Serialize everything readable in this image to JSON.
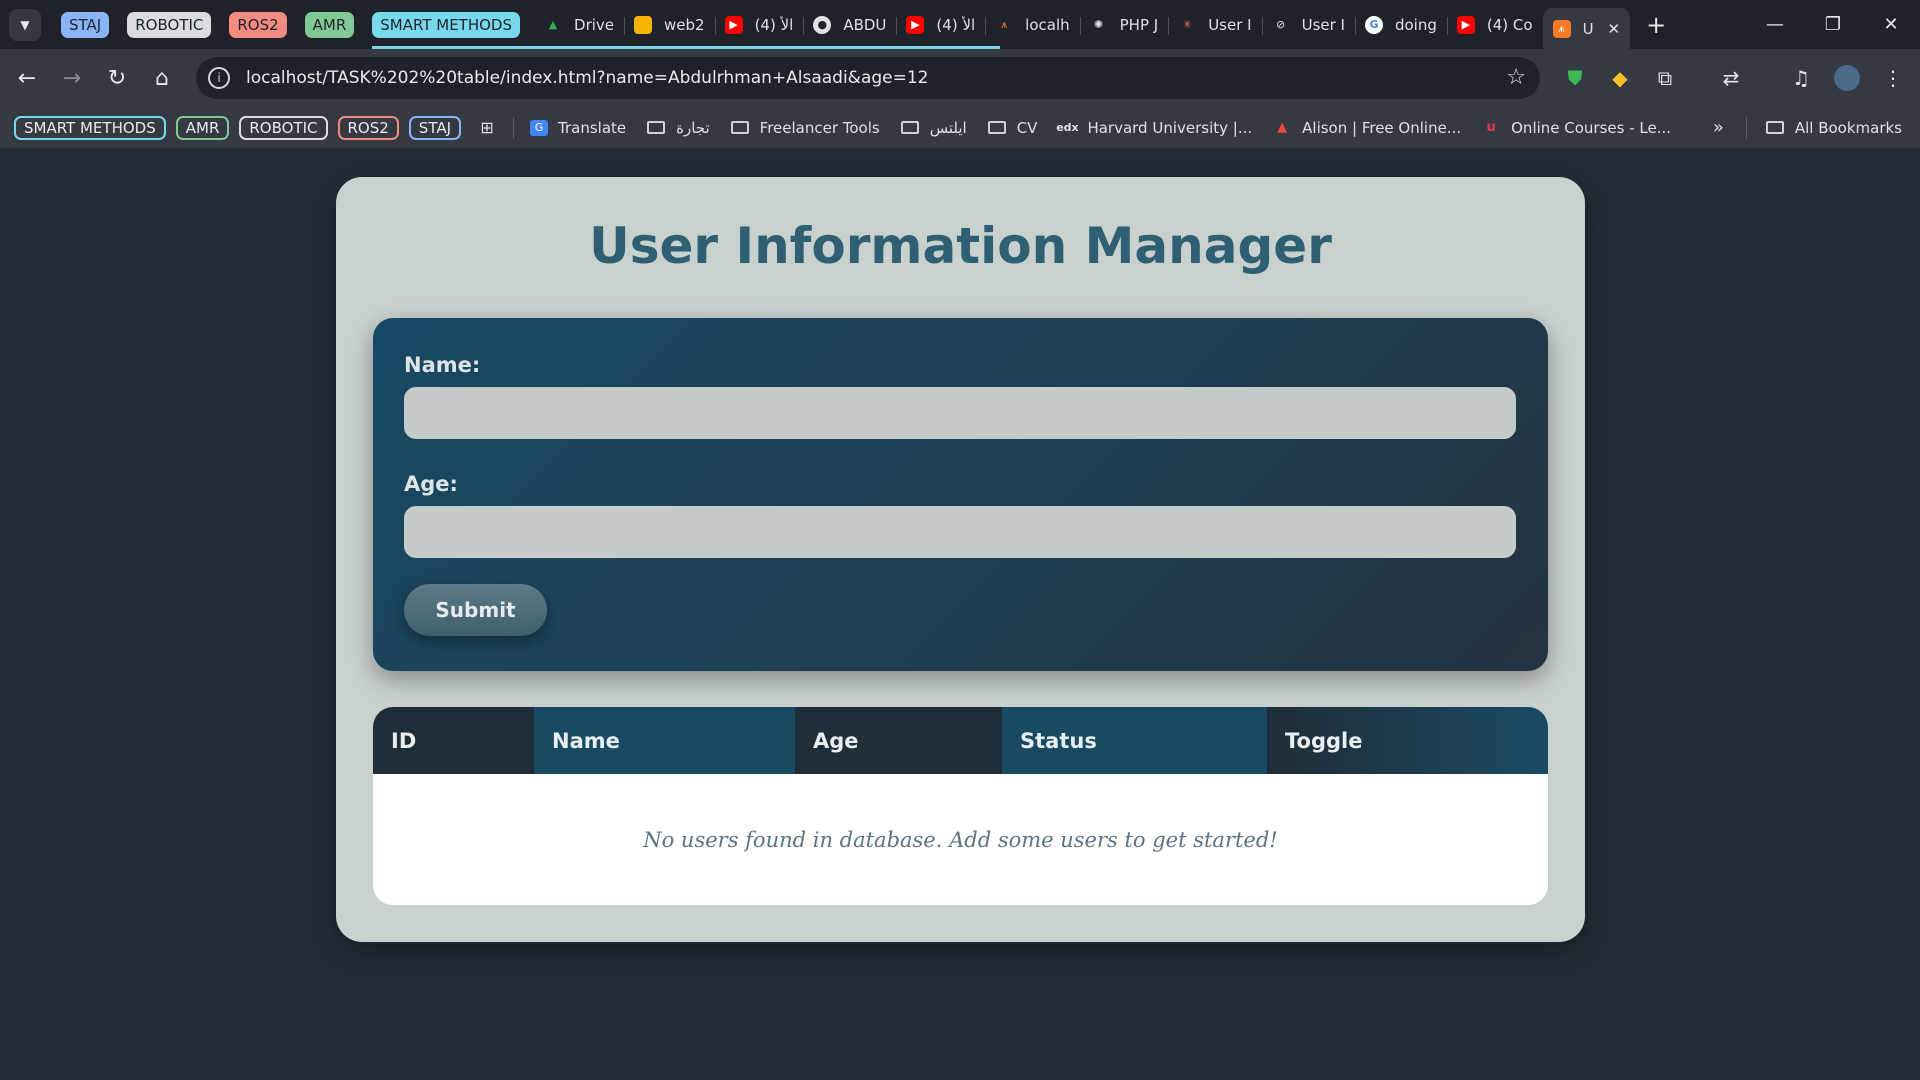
{
  "browser": {
    "tab_groups": [
      {
        "label": "STAJ",
        "color": "#8ab4f8"
      },
      {
        "label": "ROBOTIC",
        "color": "#dadce0"
      },
      {
        "label": "ROS2",
        "color": "#f28b82"
      },
      {
        "label": "AMR",
        "color": "#81c995"
      },
      {
        "label": "SMART METHODS",
        "color": "#78d9ec"
      }
    ],
    "tabs": [
      {
        "title": "Drive",
        "icon": "google-drive-icon",
        "color": "#34a853"
      },
      {
        "title": "web2",
        "icon": "slides-icon",
        "color": "#f4b400"
      },
      {
        "title": "(4) الأ",
        "icon": "youtube-icon",
        "color": "#ff0000"
      },
      {
        "title": "ABDU",
        "icon": "github-icon",
        "color": "#444444"
      },
      {
        "title": "(4) الأ",
        "icon": "youtube-icon",
        "color": "#ff0000"
      },
      {
        "title": "localh",
        "icon": "xampp-icon",
        "color": "#fb7a24"
      },
      {
        "title": "PHP J",
        "icon": "chatgpt-icon",
        "color": "#555555"
      },
      {
        "title": "User I",
        "icon": "claude-icon",
        "color": "#d97757"
      },
      {
        "title": "User I",
        "icon": "edit-icon",
        "color": "#555555"
      },
      {
        "title": "doing",
        "icon": "google-icon",
        "color": "#4285f4"
      },
      {
        "title": "(4) Co",
        "icon": "youtube-icon",
        "color": "#ff0000"
      },
      {
        "title": "U",
        "icon": "xampp-icon",
        "color": "#fb7a24",
        "active": true
      }
    ],
    "url": "localhost/TASK%202%20table/index.html?name=Abdulrhman+Alsaadi&age=12",
    "bookmark_groups": [
      {
        "label": "SMART METHODS",
        "color": "#78d9ec"
      },
      {
        "label": "AMR",
        "color": "#81c995"
      },
      {
        "label": "ROBOTIC",
        "color": "#dadce0"
      },
      {
        "label": "ROS2",
        "color": "#f28b82"
      },
      {
        "label": "STAJ",
        "color": "#8ab4f8"
      }
    ],
    "bookmarks": [
      {
        "label": "Translate",
        "icon": "translate-icon"
      },
      {
        "label": "تجارة",
        "icon": "folder-icon"
      },
      {
        "label": "Freelancer Tools",
        "icon": "folder-icon"
      },
      {
        "label": "ايلتس",
        "icon": "folder-icon"
      },
      {
        "label": "CV",
        "icon": "folder-icon"
      },
      {
        "label": "Harvard University |...",
        "icon": "edx-icon"
      },
      {
        "label": "Alison | Free Online...",
        "icon": "alison-icon"
      },
      {
        "label": "Online Courses - Le...",
        "icon": "udemy-icon"
      }
    ],
    "all_bookmarks": "All Bookmarks"
  },
  "page": {
    "title": "User Information Manager",
    "form": {
      "name_label": "Name:",
      "name_value": "",
      "age_label": "Age:",
      "age_value": "",
      "submit_label": "Submit"
    },
    "table": {
      "columns": [
        "ID",
        "Name",
        "Age",
        "Status",
        "Toggle"
      ],
      "empty_message": "No users found in database. Add some users to get started!"
    }
  },
  "colors": {
    "title": "#2f5f72",
    "header_dark": "#1f2d38",
    "header_teal": "#1a4a63"
  }
}
